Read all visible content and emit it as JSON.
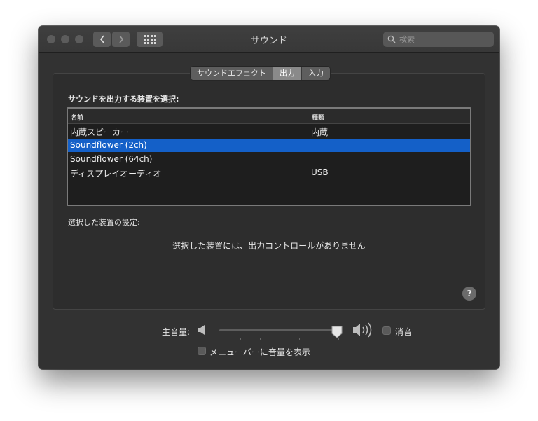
{
  "window": {
    "title": "サウンド",
    "search": {
      "placeholder": "検索",
      "icon": "search-icon"
    },
    "nav": {
      "back": "chevron-left-icon",
      "forward": "chevron-right-icon",
      "show_all": "grid-icon"
    }
  },
  "tabs": [
    {
      "label": "サウンドエフェクト",
      "active": false
    },
    {
      "label": "出力",
      "active": true
    },
    {
      "label": "入力",
      "active": false
    }
  ],
  "output": {
    "heading": "サウンドを出力する装置を選択:",
    "columns": {
      "name": "名前",
      "type": "種類"
    },
    "devices": [
      {
        "name": "内蔵スピーカー",
        "type": "内蔵",
        "selected": false
      },
      {
        "name": "Soundflower (2ch)",
        "type": "",
        "selected": true
      },
      {
        "name": "Soundflower (64ch)",
        "type": "",
        "selected": false
      },
      {
        "name": "ディスプレイオーディオ",
        "type": "USB",
        "selected": false
      }
    ],
    "settings_label": "選択した装置の設定:",
    "no_controls_message": "選択した装置には、出力コントロールがありません"
  },
  "help": {
    "label": "?"
  },
  "volume": {
    "label": "主音量:",
    "level": 1.0,
    "mute_label": "消音",
    "mute_checked": false,
    "show_in_menubar_label": "メニューバーに音量を表示",
    "show_in_menubar_checked": false
  },
  "colors": {
    "selection": "#1460c8",
    "window_bg": "#323232"
  }
}
